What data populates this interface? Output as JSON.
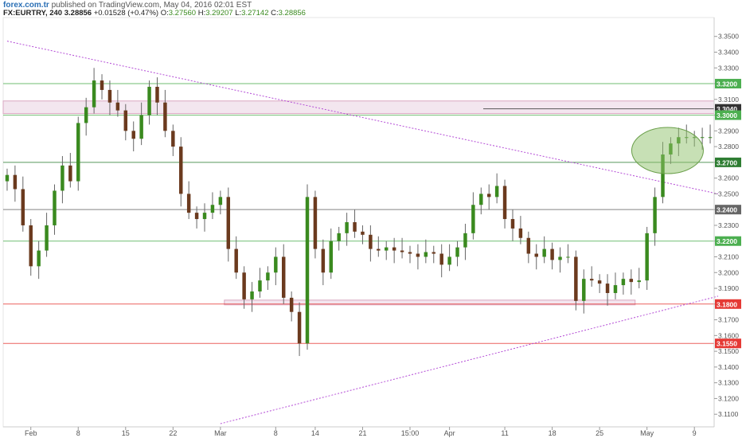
{
  "header": {
    "brand": "forex.com.tr",
    "published": "published on TradingView.com, May 04, 2016 02:01 EST",
    "symbol": "FX:EURTRY, 240",
    "last": "3.28856",
    "change": "+0.01528 (+0.47%)",
    "o_label": "O:",
    "o": "3.27560",
    "h_label": "H:",
    "h": "3.29207",
    "l_label": "L:",
    "l": "3.27142",
    "c_label": "C:",
    "c": "3.28856"
  },
  "chart_data": {
    "type": "candlestick",
    "title": "FX:EURTRY, 240",
    "xlabel": "",
    "ylabel": "",
    "ylim": [
      3.102,
      3.362
    ],
    "y_ticks": [
      "3.1100",
      "3.1200",
      "3.1300",
      "3.1400",
      "3.1500",
      "3.1600",
      "3.1700",
      "3.1800",
      "3.1900",
      "3.2000",
      "3.2100",
      "3.2200",
      "3.2300",
      "3.2400",
      "3.2500",
      "3.2600",
      "3.2700",
      "3.2800",
      "3.2900",
      "3.3000",
      "3.3100",
      "3.3200",
      "3.3300",
      "3.3400",
      "3.3500"
    ],
    "x_ticks": [
      "Feb",
      "8",
      "15",
      "22",
      "Mar",
      "8",
      "14",
      "21",
      "15:00",
      "Apr",
      "11",
      "18",
      "25",
      "May",
      "9"
    ],
    "x_tick_index": [
      3,
      9,
      15,
      21,
      27,
      34,
      39,
      45,
      51,
      56,
      63,
      69,
      75,
      81,
      87
    ],
    "n_periods": 90,
    "price_levels": [
      {
        "value": 3.32,
        "label": "3.3200",
        "color": "#4caf50"
      },
      {
        "value": 3.304,
        "label": "3.3040",
        "color": "#333333"
      },
      {
        "value": 3.3,
        "label": "3.3000",
        "color": "#4caf50"
      },
      {
        "value": 3.27,
        "label": "3.2700",
        "color": "#2e7d32"
      },
      {
        "value": 3.24,
        "label": "3.2400",
        "color": "#666666"
      },
      {
        "value": 3.22,
        "label": "3.2200",
        "color": "#4caf50"
      },
      {
        "value": 3.18,
        "label": "3.1800",
        "color": "#e53935"
      },
      {
        "value": 3.155,
        "label": "3.1550",
        "color": "#e53935"
      }
    ],
    "zones": [
      {
        "from": 3.301,
        "to": 3.309
      },
      {
        "from": 3.1795,
        "to": 3.1825,
        "start": 28,
        "end": 79
      }
    ],
    "trendlines": [
      {
        "x1": 0,
        "y1": 3.347,
        "x2": 90,
        "y2": 3.25
      },
      {
        "x1": 27,
        "y1": 3.104,
        "x2": 90,
        "y2": 3.185
      }
    ],
    "highlight": {
      "index": 83.6,
      "price": 3.2775
    },
    "close": [
      3.262,
      3.253,
      3.23,
      3.204,
      3.214,
      3.23,
      3.252,
      3.268,
      3.258,
      3.295,
      3.305,
      3.322,
      3.316,
      3.308,
      3.303,
      3.29,
      3.285,
      3.3,
      3.318,
      3.308,
      3.29,
      3.28,
      3.25,
      3.238,
      3.234,
      3.238,
      3.243,
      3.248,
      3.215,
      3.2,
      3.183,
      3.188,
      3.195,
      3.2,
      3.21,
      3.184,
      3.175,
      3.155,
      3.248,
      3.215,
      3.2,
      3.22,
      3.225,
      3.232,
      3.226,
      3.224,
      3.215,
      3.214,
      3.216,
      3.214,
      3.213,
      3.212,
      3.21,
      3.213,
      3.212,
      3.205,
      3.21,
      3.216,
      3.225,
      3.243,
      3.25,
      3.248,
      3.255,
      3.234,
      3.228,
      3.222,
      3.212,
      3.21,
      3.215,
      3.208,
      3.21,
      3.21,
      3.182,
      3.196,
      3.195,
      3.193,
      3.187,
      3.192,
      3.196,
      3.194,
      3.195,
      3.225,
      3.248,
      3.275,
      3.282,
      3.286,
      3.286,
      3.286,
      3.286,
      3.286
    ]
  }
}
